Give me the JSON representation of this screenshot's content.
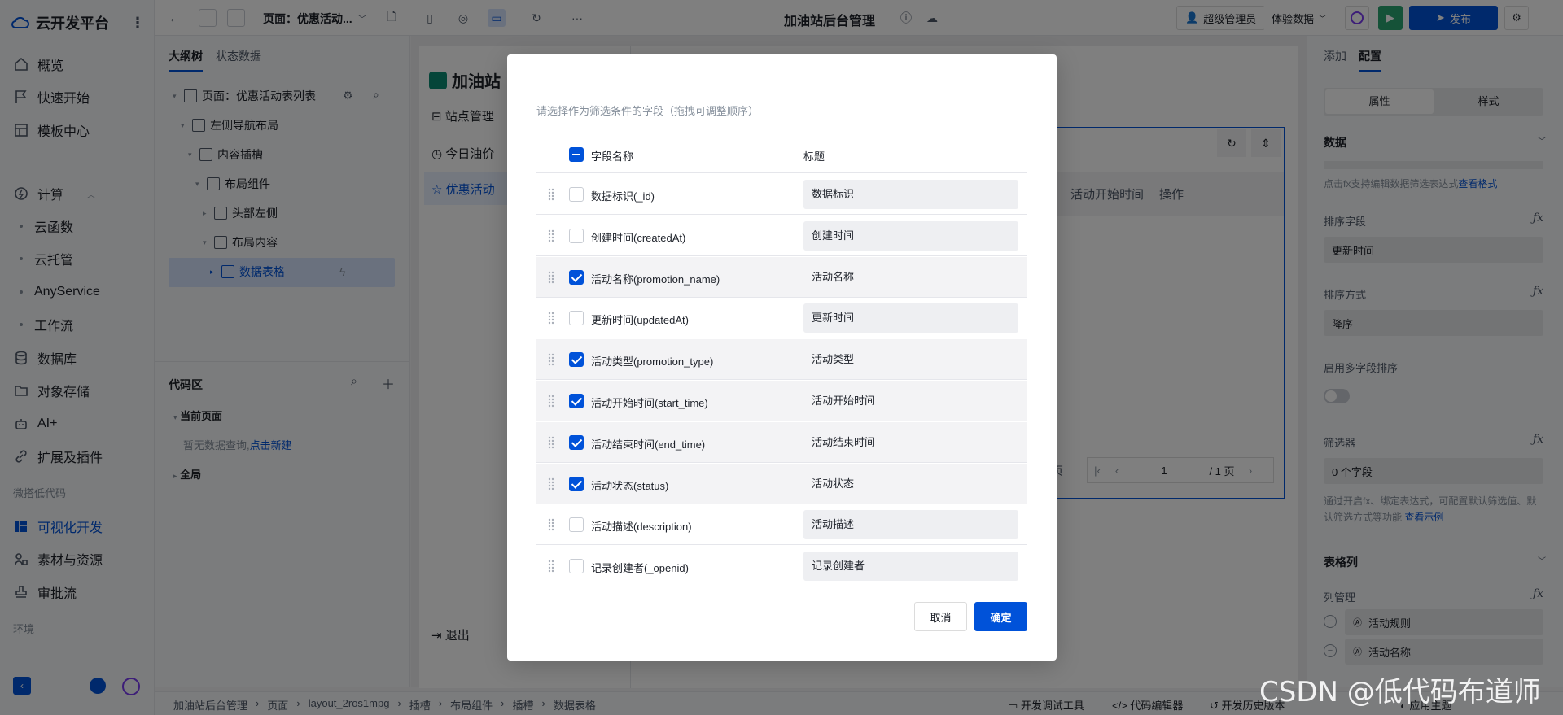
{
  "nav": {
    "brand": "云开发平台",
    "items": [
      "概览",
      "快速开始",
      "模板中心"
    ],
    "compute": "计算",
    "compute_sub": [
      "云函数",
      "云托管",
      "AnyService",
      "工作流"
    ],
    "items2": [
      "数据库",
      "对象存储",
      "AI+",
      "扩展及插件"
    ],
    "group_lowcode": "微搭低代码",
    "lowcode_items": [
      "可视化开发",
      "素材与资源",
      "审批流"
    ],
    "group_env": "环境"
  },
  "topbar": {
    "page_label": "页面：优惠活动...",
    "title": "加油站后台管理",
    "admin": "超级管理员",
    "data_mode": "体验数据",
    "publish": "发布"
  },
  "outline": {
    "tabs": [
      "大纲树",
      "状态数据"
    ],
    "tree": [
      "页面：优惠活动表列表",
      "左侧导航布局",
      "内容插槽",
      "布局组件",
      "头部左侧",
      "布局内容",
      "数据表格"
    ]
  },
  "code": {
    "title": "代码区",
    "current_page": "当前页面",
    "empty_text": "暂无数据查询,",
    "create_link": "点击新建",
    "global": "全局"
  },
  "canvas": {
    "app_title": "加油站",
    "menu": [
      "站点管理",
      "今日油价",
      "优惠活动"
    ],
    "logout": "退出",
    "col_start": "活动开始时间",
    "col_action": "操作",
    "page_suffix": "页",
    "page_input": "1",
    "page_total": "/ 1 页"
  },
  "rpanel": {
    "tabs": [
      "添加",
      "配置"
    ],
    "seg": [
      "属性",
      "样式"
    ],
    "data_section": "数据",
    "hint": "点击fx支持编辑数据筛选表达式",
    "hint_link": "查看格式",
    "sort_field_label": "排序字段",
    "sort_field_value": "更新时间",
    "sort_order_label": "排序方式",
    "sort_order_value": "降序",
    "multi_sort_label": "启用多字段排序",
    "filter_label": "筛选器",
    "filter_value": "0 个字段",
    "filter_hint": "通过开启fx、绑定表达式，可配置默认筛选值、默认筛选方式等功能",
    "filter_hint_link": "查看示例",
    "table_cols": "表格列",
    "col_mgmt": "列管理",
    "cols": [
      "活动规则",
      "活动名称"
    ]
  },
  "status": {
    "breadcrumb": [
      "加油站后台管理",
      "页面",
      "layout_2ros1mpg",
      "插槽",
      "布局组件",
      "插槽",
      "数据表格"
    ],
    "tools": [
      "开发调试工具",
      "代码编辑器",
      "开发历史版本",
      "应用主题"
    ]
  },
  "dialog": {
    "hint": "请选择作为筛选条件的字段（拖拽可调整顺序）",
    "col_field": "字段名称",
    "col_title": "标题",
    "rows": [
      {
        "field": "数据标识(_id)",
        "title": "数据标识",
        "checked": false
      },
      {
        "field": "创建时间(createdAt)",
        "title": "创建时间",
        "checked": false
      },
      {
        "field": "活动名称(promotion_name)",
        "title": "活动名称",
        "checked": true
      },
      {
        "field": "更新时间(updatedAt)",
        "title": "更新时间",
        "checked": false
      },
      {
        "field": "活动类型(promotion_type)",
        "title": "活动类型",
        "checked": true
      },
      {
        "field": "活动开始时间(start_time)",
        "title": "活动开始时间",
        "checked": true
      },
      {
        "field": "活动结束时间(end_time)",
        "title": "活动结束时间",
        "checked": true
      },
      {
        "field": "活动状态(status)",
        "title": "活动状态",
        "checked": true
      },
      {
        "field": "活动描述(description)",
        "title": "活动描述",
        "checked": false
      },
      {
        "field": "记录创建者(_openid)",
        "title": "记录创建者",
        "checked": false
      }
    ],
    "cancel": "取消",
    "ok": "确定"
  },
  "watermark": "CSDN @低代码布道师",
  "colors": {
    "accent": "#0052d9",
    "run": "#2ba471"
  }
}
